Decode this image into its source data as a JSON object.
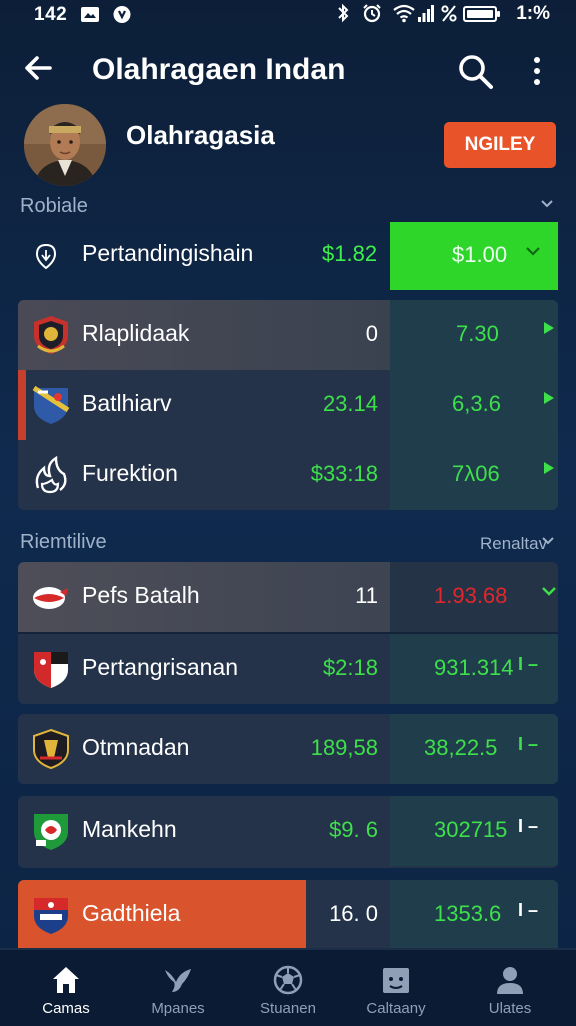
{
  "status_bar": {
    "time": "142",
    "left_icons": [
      "photo-icon",
      "shield-icon"
    ],
    "battery_text": "1:%"
  },
  "app_bar": {
    "title": "Olahragaen Indan"
  },
  "profile": {
    "name": "Olahragasia",
    "follow_label": "NGILEY"
  },
  "section1": {
    "label": "Robiale"
  },
  "highlight": {
    "name": "Pertandingishain",
    "mid_value": "$1.82",
    "odds": "$1.00",
    "odds_icon": "chevron-down-icon"
  },
  "card1": {
    "rows": [
      {
        "name": "Rlaplidaak",
        "mid": "0",
        "value": "7.30",
        "arrow": "▸",
        "bar": "#b3392a",
        "bar_width": 1.0
      },
      {
        "name": "Batlhiarv",
        "mid": "23.14",
        "value": "6,3.6",
        "arrow": "▸",
        "bar": "#b3392a",
        "bar_width": 0.0
      },
      {
        "name": "Furektion",
        "mid": "$33:18",
        "value": "7λ06",
        "arrow": "▸",
        "bar": "",
        "bar_width": 0
      }
    ]
  },
  "section2": {
    "label": "Riemtilive",
    "right_label": "Renaltav"
  },
  "card2": {
    "rows": [
      {
        "name": "Pefs Batalh",
        "mid": "11",
        "value": "1.93.68",
        "arrow": "⌄",
        "value_color": "#e2262a"
      },
      {
        "name": "Pertangrisanan",
        "mid": "$2:18",
        "value": "931.314",
        "arrow": "I –",
        "value_color": "#3de04a"
      }
    ]
  },
  "card3": {
    "rows": [
      {
        "name": "Otmnadan",
        "mid": "189,58",
        "value": "38,22.5",
        "arrow": "I –"
      }
    ]
  },
  "card4": {
    "rows": [
      {
        "name": "Mankehn",
        "mid": "$9. 6",
        "value": "302715",
        "arrow": "I –"
      }
    ]
  },
  "card5": {
    "rows": [
      {
        "name": "Gadthiela",
        "mid": "16. 0",
        "value": "1353.6",
        "arrow": "I –"
      }
    ]
  },
  "colors": {
    "accent_green": "#2fd62a",
    "follow_orange": "#e8532a",
    "highlight_orange": "#d9532c",
    "negative_red": "#e2262a"
  },
  "bottom_nav": [
    {
      "label": "Camas",
      "icon": "home-icon",
      "active": true
    },
    {
      "label": "Mpanes",
      "icon": "bird-icon",
      "active": false
    },
    {
      "label": "Stuanen",
      "icon": "ball-icon",
      "active": false
    },
    {
      "label": "Caltaany",
      "icon": "calendar-icon",
      "active": false
    },
    {
      "label": "Ulates",
      "icon": "user-icon",
      "active": false
    }
  ]
}
